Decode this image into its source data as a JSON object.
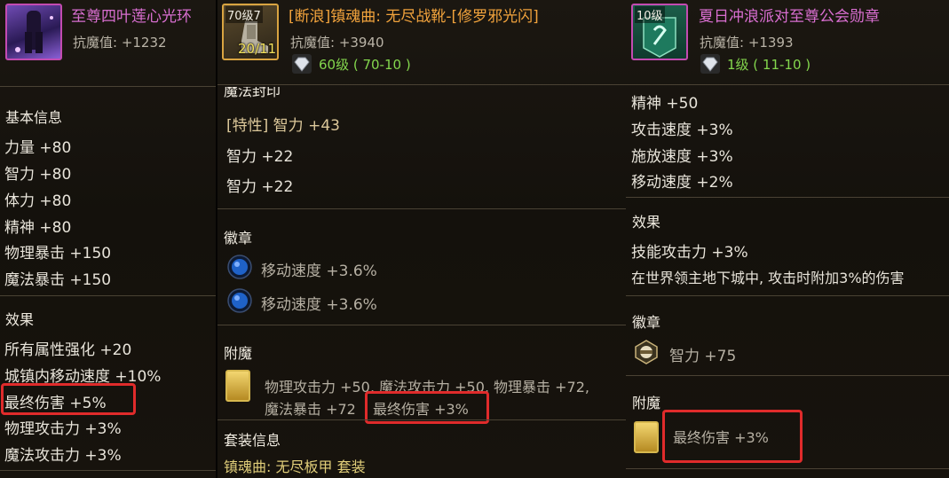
{
  "panel1": {
    "title": "至尊四叶莲心光环",
    "magic_defense": "抗魔值: +1232",
    "sections": [
      {
        "heading": "基本信息",
        "lines": [
          "力量 +80",
          "智力 +80",
          "体力 +80",
          "精神 +80",
          "物理暴击 +150",
          "魔法暴击 +150"
        ]
      },
      {
        "heading": "效果",
        "lines": [
          "所有属性强化 +20",
          "城镇内移动速度 +10%",
          "最终伤害 +5%",
          "物理攻击力 +3%",
          "魔法攻击力 +3%"
        ]
      }
    ]
  },
  "panel2": {
    "icon_level": "70级7",
    "icon_count": "20/11",
    "title": "[断浪]镇魂曲: 无尽战靴-[修罗邪光闪]",
    "magic_defense": "抗魔值: +3940",
    "level": "60级 ( 70-10 )",
    "seal_heading": "魔法封印",
    "seal_lines": [
      "[特性] 智力 +43",
      "智力 +22",
      "智力 +22"
    ],
    "emblem_heading": "徽章",
    "emblems": [
      "移动速度 +3.6%",
      "移动速度 +3.6%"
    ],
    "enchant_heading": "附魔",
    "enchant_line1": "物理攻击力 +50, 魔法攻击力 +50, 物理暴击 +72,",
    "enchant_line2_prefix": "魔法暴击 +72",
    "enchant_line2_highlight": "最终伤害 +3%",
    "set_heading": "套装信息",
    "set_name": "镇魂曲: 无尽板甲 套装"
  },
  "panel3": {
    "icon_level": "10级",
    "title": "夏日冲浪派对至尊公会勋章",
    "magic_defense": "抗魔值: +1393",
    "level": "1级 ( 11-10 )",
    "stat_lines": [
      "精神 +50",
      "攻击速度 +3%",
      "施放速度 +3%",
      "移动速度 +2%"
    ],
    "effect_heading": "效果",
    "effect_lines": [
      "技能攻击力 +3%",
      "在世界领主地下城中, 攻击时附加3%的伤害"
    ],
    "emblem_heading": "徽章",
    "emblem": "智力 +75",
    "enchant_heading": "附魔",
    "enchant": "最终伤害 +3%"
  },
  "colors": {
    "title_pink": "#d86ed0",
    "title_orange": "#f0a23c",
    "level_green": "#83d64d",
    "highlight_red": "#e02b2b"
  }
}
